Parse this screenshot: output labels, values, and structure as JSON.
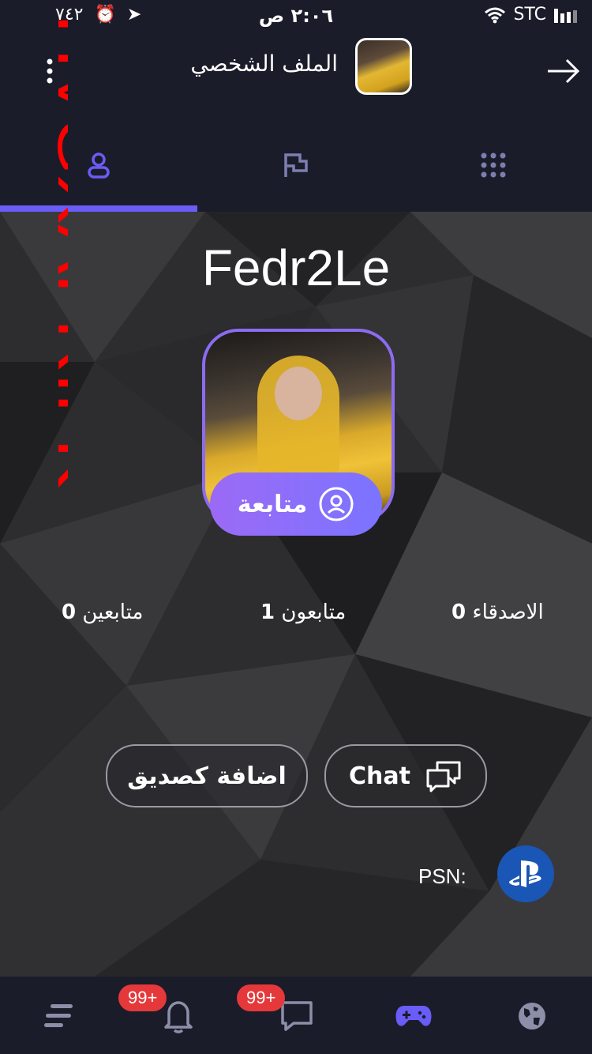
{
  "status_bar": {
    "carrier": "STC",
    "time": "٢:٠٦ ص",
    "battery": "٧٤٢"
  },
  "header": {
    "title": "الملف الشخصي"
  },
  "watermark": "HVGXAFRIFK",
  "profile": {
    "username": "Fedr2Le",
    "follow_label": "متابعة",
    "stats": {
      "following_count": "0",
      "following_label": "متابعين",
      "followers_count": "1",
      "followers_label": "متابعون",
      "friends_count": "0",
      "friends_label": "الاصدقاء"
    },
    "add_friend_label": "اضافة كصديق",
    "chat_label": "Chat",
    "psn_label": "PSN:"
  },
  "bottom_nav": {
    "notifications_badge": "99+",
    "messages_badge": "99+"
  },
  "colors": {
    "accent": "#6a5cf6",
    "background": "#1b1c2a",
    "badge": "#e5383b",
    "psn_blue": "#1a56b5"
  }
}
